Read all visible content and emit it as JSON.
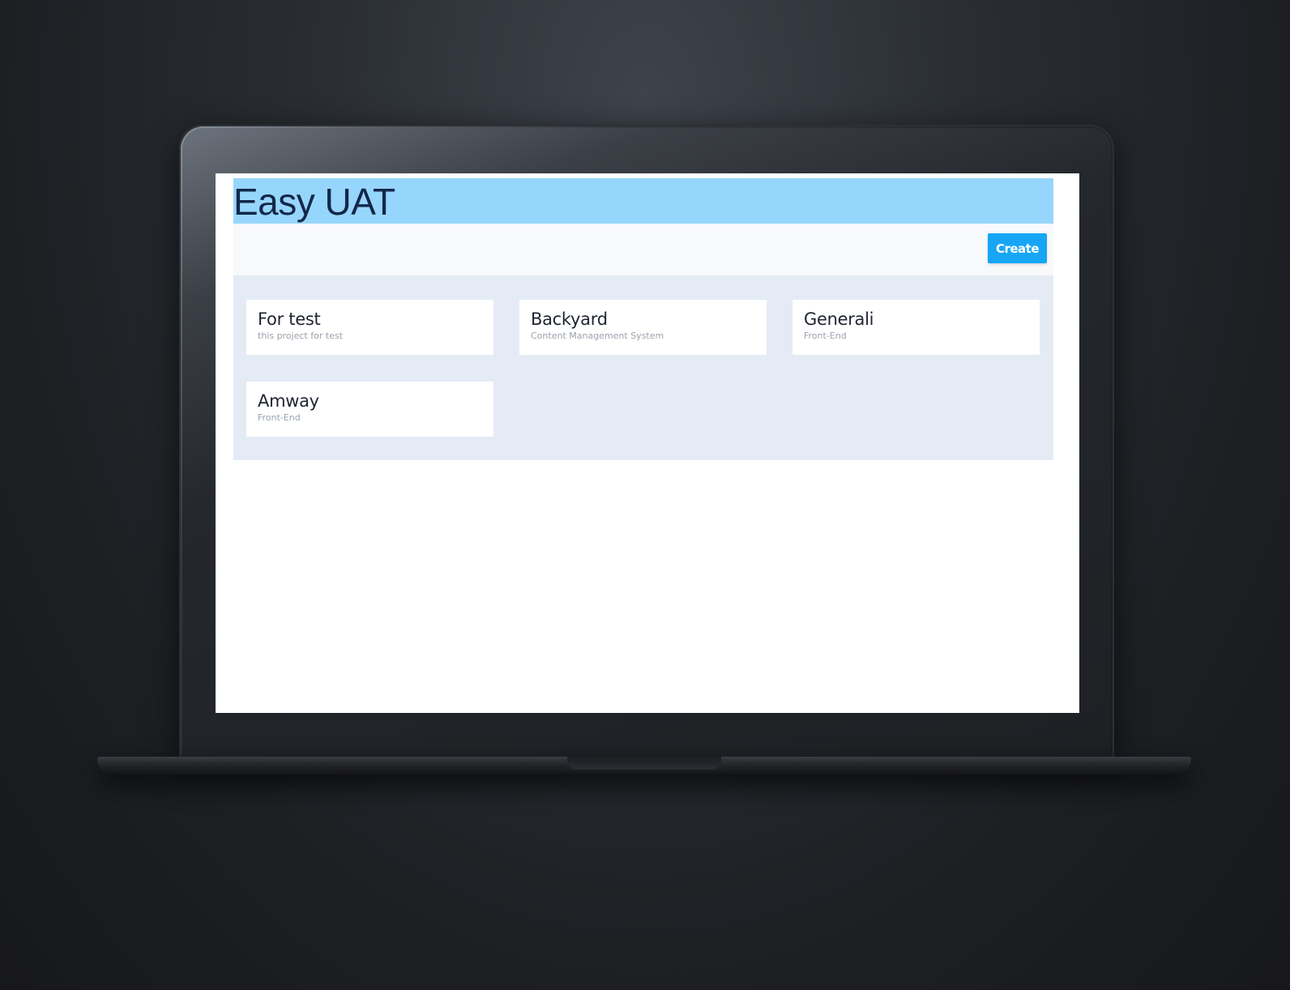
{
  "app": {
    "title": "Easy UAT"
  },
  "toolbar": {
    "create_label": "Create"
  },
  "projects": [
    {
      "name": "For test",
      "description": "this project for test"
    },
    {
      "name": "Backyard",
      "description": "Content Management System"
    },
    {
      "name": "Generali",
      "description": "Front-End"
    },
    {
      "name": "Amway",
      "description": "Front-End"
    }
  ],
  "colors": {
    "header_background": "#97d6fc",
    "title_text": "#13284a",
    "create_button": "#17a6f6",
    "panel_background": "#e4ebf5",
    "card_background": "#ffffff"
  }
}
